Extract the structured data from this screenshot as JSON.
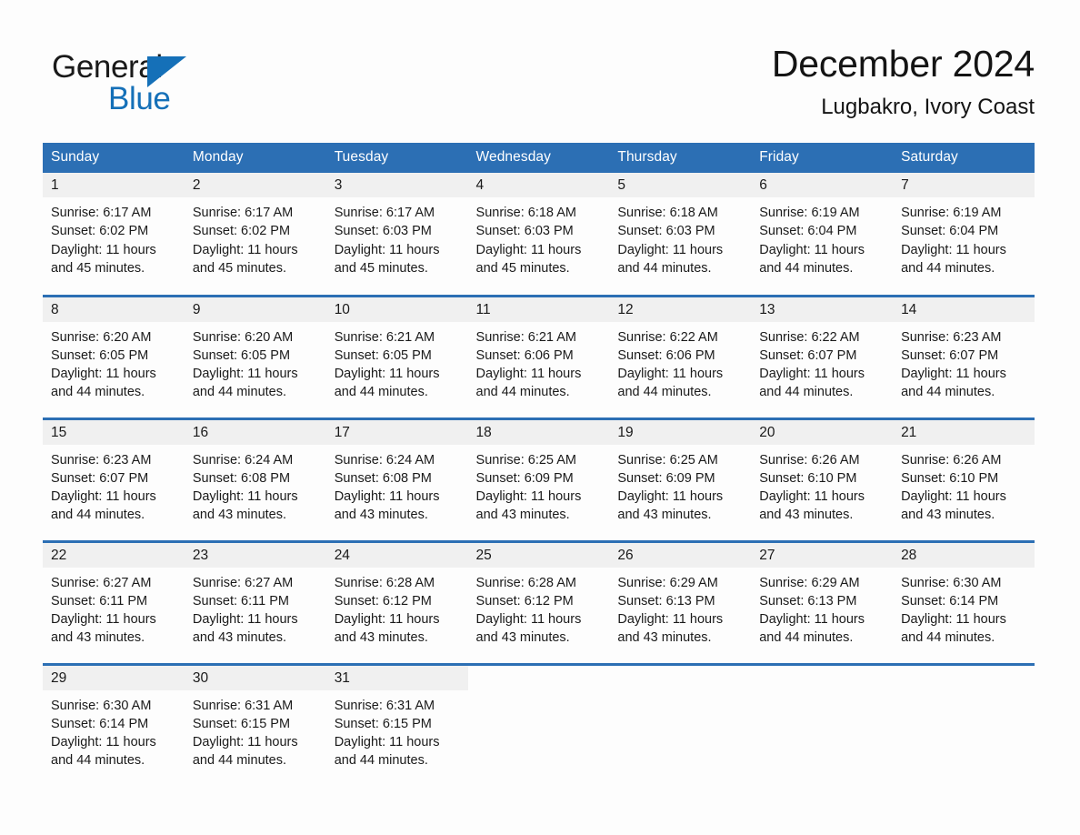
{
  "brand": {
    "word_general": "General",
    "word_blue": "Blue",
    "triangle_icon": "triangle-icon",
    "accent_color": "#1570b8"
  },
  "header": {
    "month_year": "December 2024",
    "location": "Lugbakro, Ivory Coast"
  },
  "colors": {
    "header_blue": "#2c6fb4",
    "daynum_band": "#f0f0f0",
    "page_bg": "#fdfdfd",
    "text": "#1a1a1a"
  },
  "calendar": {
    "weekday_headers": [
      "Sunday",
      "Monday",
      "Tuesday",
      "Wednesday",
      "Thursday",
      "Friday",
      "Saturday"
    ],
    "labels": {
      "sunrise": "Sunrise:",
      "sunset": "Sunset:",
      "daylight": "Daylight:"
    },
    "weeks": [
      [
        {
          "day": "1",
          "sunrise": "Sunrise: 6:17 AM",
          "sunset": "Sunset: 6:02 PM",
          "daylight": "Daylight: 11 hours and 45 minutes."
        },
        {
          "day": "2",
          "sunrise": "Sunrise: 6:17 AM",
          "sunset": "Sunset: 6:02 PM",
          "daylight": "Daylight: 11 hours and 45 minutes."
        },
        {
          "day": "3",
          "sunrise": "Sunrise: 6:17 AM",
          "sunset": "Sunset: 6:03 PM",
          "daylight": "Daylight: 11 hours and 45 minutes."
        },
        {
          "day": "4",
          "sunrise": "Sunrise: 6:18 AM",
          "sunset": "Sunset: 6:03 PM",
          "daylight": "Daylight: 11 hours and 45 minutes."
        },
        {
          "day": "5",
          "sunrise": "Sunrise: 6:18 AM",
          "sunset": "Sunset: 6:03 PM",
          "daylight": "Daylight: 11 hours and 44 minutes."
        },
        {
          "day": "6",
          "sunrise": "Sunrise: 6:19 AM",
          "sunset": "Sunset: 6:04 PM",
          "daylight": "Daylight: 11 hours and 44 minutes."
        },
        {
          "day": "7",
          "sunrise": "Sunrise: 6:19 AM",
          "sunset": "Sunset: 6:04 PM",
          "daylight": "Daylight: 11 hours and 44 minutes."
        }
      ],
      [
        {
          "day": "8",
          "sunrise": "Sunrise: 6:20 AM",
          "sunset": "Sunset: 6:05 PM",
          "daylight": "Daylight: 11 hours and 44 minutes."
        },
        {
          "day": "9",
          "sunrise": "Sunrise: 6:20 AM",
          "sunset": "Sunset: 6:05 PM",
          "daylight": "Daylight: 11 hours and 44 minutes."
        },
        {
          "day": "10",
          "sunrise": "Sunrise: 6:21 AM",
          "sunset": "Sunset: 6:05 PM",
          "daylight": "Daylight: 11 hours and 44 minutes."
        },
        {
          "day": "11",
          "sunrise": "Sunrise: 6:21 AM",
          "sunset": "Sunset: 6:06 PM",
          "daylight": "Daylight: 11 hours and 44 minutes."
        },
        {
          "day": "12",
          "sunrise": "Sunrise: 6:22 AM",
          "sunset": "Sunset: 6:06 PM",
          "daylight": "Daylight: 11 hours and 44 minutes."
        },
        {
          "day": "13",
          "sunrise": "Sunrise: 6:22 AM",
          "sunset": "Sunset: 6:07 PM",
          "daylight": "Daylight: 11 hours and 44 minutes."
        },
        {
          "day": "14",
          "sunrise": "Sunrise: 6:23 AM",
          "sunset": "Sunset: 6:07 PM",
          "daylight": "Daylight: 11 hours and 44 minutes."
        }
      ],
      [
        {
          "day": "15",
          "sunrise": "Sunrise: 6:23 AM",
          "sunset": "Sunset: 6:07 PM",
          "daylight": "Daylight: 11 hours and 44 minutes."
        },
        {
          "day": "16",
          "sunrise": "Sunrise: 6:24 AM",
          "sunset": "Sunset: 6:08 PM",
          "daylight": "Daylight: 11 hours and 43 minutes."
        },
        {
          "day": "17",
          "sunrise": "Sunrise: 6:24 AM",
          "sunset": "Sunset: 6:08 PM",
          "daylight": "Daylight: 11 hours and 43 minutes."
        },
        {
          "day": "18",
          "sunrise": "Sunrise: 6:25 AM",
          "sunset": "Sunset: 6:09 PM",
          "daylight": "Daylight: 11 hours and 43 minutes."
        },
        {
          "day": "19",
          "sunrise": "Sunrise: 6:25 AM",
          "sunset": "Sunset: 6:09 PM",
          "daylight": "Daylight: 11 hours and 43 minutes."
        },
        {
          "day": "20",
          "sunrise": "Sunrise: 6:26 AM",
          "sunset": "Sunset: 6:10 PM",
          "daylight": "Daylight: 11 hours and 43 minutes."
        },
        {
          "day": "21",
          "sunrise": "Sunrise: 6:26 AM",
          "sunset": "Sunset: 6:10 PM",
          "daylight": "Daylight: 11 hours and 43 minutes."
        }
      ],
      [
        {
          "day": "22",
          "sunrise": "Sunrise: 6:27 AM",
          "sunset": "Sunset: 6:11 PM",
          "daylight": "Daylight: 11 hours and 43 minutes."
        },
        {
          "day": "23",
          "sunrise": "Sunrise: 6:27 AM",
          "sunset": "Sunset: 6:11 PM",
          "daylight": "Daylight: 11 hours and 43 minutes."
        },
        {
          "day": "24",
          "sunrise": "Sunrise: 6:28 AM",
          "sunset": "Sunset: 6:12 PM",
          "daylight": "Daylight: 11 hours and 43 minutes."
        },
        {
          "day": "25",
          "sunrise": "Sunrise: 6:28 AM",
          "sunset": "Sunset: 6:12 PM",
          "daylight": "Daylight: 11 hours and 43 minutes."
        },
        {
          "day": "26",
          "sunrise": "Sunrise: 6:29 AM",
          "sunset": "Sunset: 6:13 PM",
          "daylight": "Daylight: 11 hours and 43 minutes."
        },
        {
          "day": "27",
          "sunrise": "Sunrise: 6:29 AM",
          "sunset": "Sunset: 6:13 PM",
          "daylight": "Daylight: 11 hours and 44 minutes."
        },
        {
          "day": "28",
          "sunrise": "Sunrise: 6:30 AM",
          "sunset": "Sunset: 6:14 PM",
          "daylight": "Daylight: 11 hours and 44 minutes."
        }
      ],
      [
        {
          "day": "29",
          "sunrise": "Sunrise: 6:30 AM",
          "sunset": "Sunset: 6:14 PM",
          "daylight": "Daylight: 11 hours and 44 minutes."
        },
        {
          "day": "30",
          "sunrise": "Sunrise: 6:31 AM",
          "sunset": "Sunset: 6:15 PM",
          "daylight": "Daylight: 11 hours and 44 minutes."
        },
        {
          "day": "31",
          "sunrise": "Sunrise: 6:31 AM",
          "sunset": "Sunset: 6:15 PM",
          "daylight": "Daylight: 11 hours and 44 minutes."
        },
        {
          "day": "",
          "sunrise": "",
          "sunset": "",
          "daylight": ""
        },
        {
          "day": "",
          "sunrise": "",
          "sunset": "",
          "daylight": ""
        },
        {
          "day": "",
          "sunrise": "",
          "sunset": "",
          "daylight": ""
        },
        {
          "day": "",
          "sunrise": "",
          "sunset": "",
          "daylight": ""
        }
      ]
    ]
  }
}
